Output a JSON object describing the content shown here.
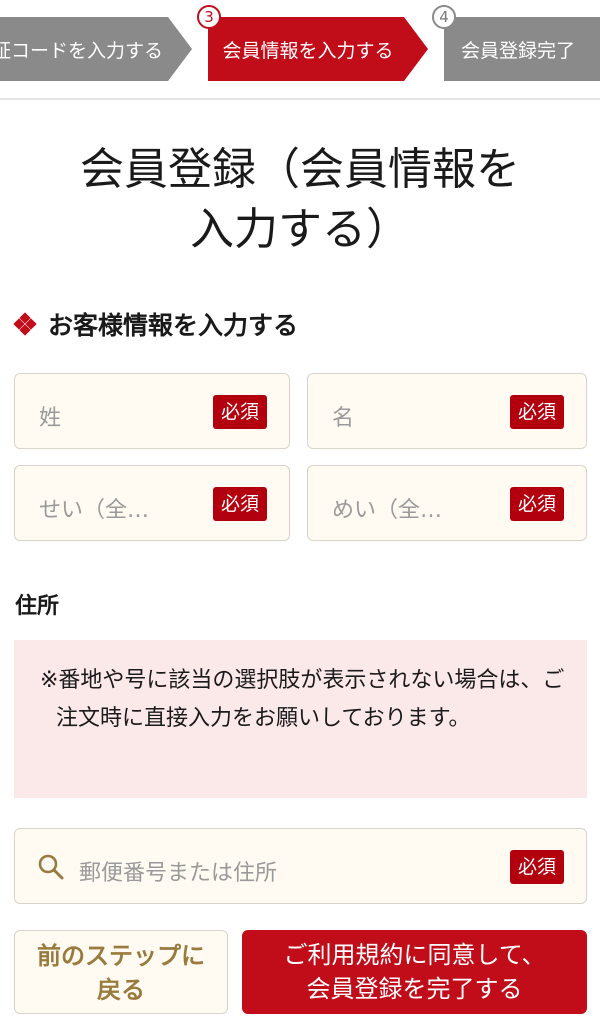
{
  "stepper": {
    "step2_label": "証コードを入力する",
    "step3_number": "3",
    "step3_label": "会員情報を入力する",
    "step4_number": "4",
    "step4_label": "会員登録完了"
  },
  "title": {
    "line1": "会員登録（会員情報を",
    "line2": "入力する）"
  },
  "section": {
    "icon": "diamond-icon",
    "title": "お客様情報を入力する"
  },
  "fields": {
    "last_name_placeholder": "姓",
    "first_name_placeholder": "名",
    "last_kana_placeholder": "せい（全…",
    "first_kana_placeholder": "めい（全…",
    "required_label": "必須"
  },
  "address": {
    "label": "住所",
    "notice": "※番地や号に該当の選択肢が表示されない場合は、ご注文時に直接入力をお願いしております。",
    "search_icon": "search-icon",
    "search_placeholder": "郵便番号または住所"
  },
  "buttons": {
    "back_line1": "前のステップに",
    "back_line2": "戻る",
    "submit_line1": "ご利用規約に同意して、",
    "submit_line2": "会員登録を完了する"
  },
  "colors": {
    "accent": "#c10d19",
    "step_inactive": "#8a8a8a",
    "field_bg": "#fffbf2",
    "notice_bg": "#fbe8e9",
    "back_text": "#9a7b3d"
  }
}
